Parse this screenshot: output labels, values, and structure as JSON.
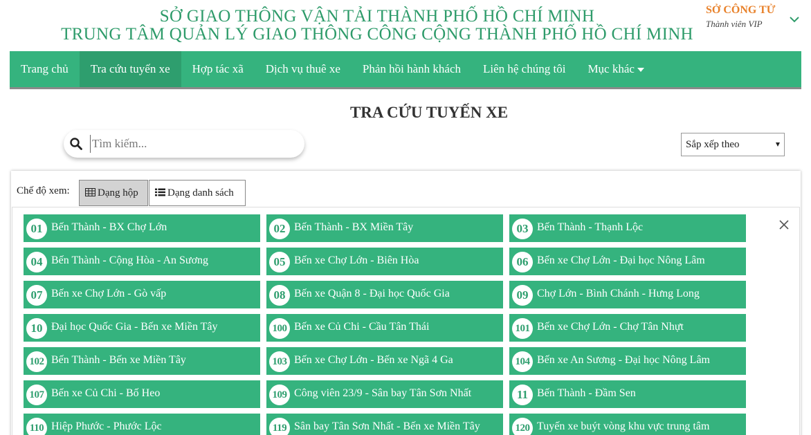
{
  "header": {
    "org_line1": "SỞ GIAO THÔNG VẬN TẢI THÀNH PHỐ HỒ CHÍ MINH",
    "org_line2": "TRUNG TÂM QUẢN LÝ GIAO THÔNG CÔNG CỘNG THÀNH PHỐ HỒ CHÍ MINH",
    "user_name": "SỞ CÔNG TỬ",
    "user_role": "Thành viên VIP"
  },
  "nav": {
    "items": [
      {
        "label": "Trang chủ"
      },
      {
        "label": "Tra cứu tuyến xe",
        "active": true
      },
      {
        "label": "Hợp tác xã"
      },
      {
        "label": "Dịch vụ thuê xe"
      },
      {
        "label": "Phản hồi hành khách"
      },
      {
        "label": "Liên hệ chúng tôi"
      },
      {
        "label": "Mục khác"
      }
    ]
  },
  "page": {
    "title": "TRA CỨU TUYẾN XE"
  },
  "search": {
    "placeholder": "Tìm kiếm...",
    "value": ""
  },
  "sort": {
    "selected": "Sắp xếp theo"
  },
  "view": {
    "label": "Chế độ xem:",
    "grid_label": "Dạng hộp",
    "list_label": "Dạng danh sách",
    "selected": "grid"
  },
  "routes": [
    {
      "num": "01",
      "name": "Bến Thành - BX Chợ Lớn"
    },
    {
      "num": "02",
      "name": "Bến Thành - BX Miền Tây"
    },
    {
      "num": "03",
      "name": "Bến Thành - Thạnh Lộc"
    },
    {
      "num": "04",
      "name": "Bến Thành - Cộng Hòa - An Sương"
    },
    {
      "num": "05",
      "name": "Bến xe Chợ Lớn - Biên Hòa"
    },
    {
      "num": "06",
      "name": "Bến xe Chợ Lớn - Đại học Nông Lâm"
    },
    {
      "num": "07",
      "name": "Bến xe Chợ Lớn - Gò vấp"
    },
    {
      "num": "08",
      "name": "Bến xe Quận 8 - Đại học Quốc Gia"
    },
    {
      "num": "09",
      "name": "Chợ Lớn - Bình Chánh - Hưng Long"
    },
    {
      "num": "10",
      "name": "Đại học Quốc Gia - Bến xe Miền Tây"
    },
    {
      "num": "100",
      "name": "Bến xe Củ Chi - Cầu Tân Thái"
    },
    {
      "num": "101",
      "name": "Bến xe Chợ Lớn - Chợ Tân Nhựt"
    },
    {
      "num": "102",
      "name": "Bến Thành - Bến xe Miền Tây"
    },
    {
      "num": "103",
      "name": "Bến xe Chợ Lớn - Bến xe Ngã 4 Ga"
    },
    {
      "num": "104",
      "name": "Bến xe An Sương - Đại học Nông Lâm"
    },
    {
      "num": "107",
      "name": "Bến xe Củ Chi - Bố Heo"
    },
    {
      "num": "109",
      "name": "Công viên 23/9 - Sân bay Tân Sơn Nhất"
    },
    {
      "num": "11",
      "name": "Bến Thành - Đầm Sen"
    },
    {
      "num": "110",
      "name": "Hiệp Phước - Phước Lộc"
    },
    {
      "num": "119",
      "name": "Sân bay Tân Sơn Nhất - Bến xe Miền Tây"
    },
    {
      "num": "120",
      "name": "Tuyến xe buýt vòng khu vực trung tâm"
    }
  ],
  "colors": {
    "brand_green": "#35b37e",
    "title_green": "#2e9b6a",
    "user_orange": "#e8812a"
  }
}
